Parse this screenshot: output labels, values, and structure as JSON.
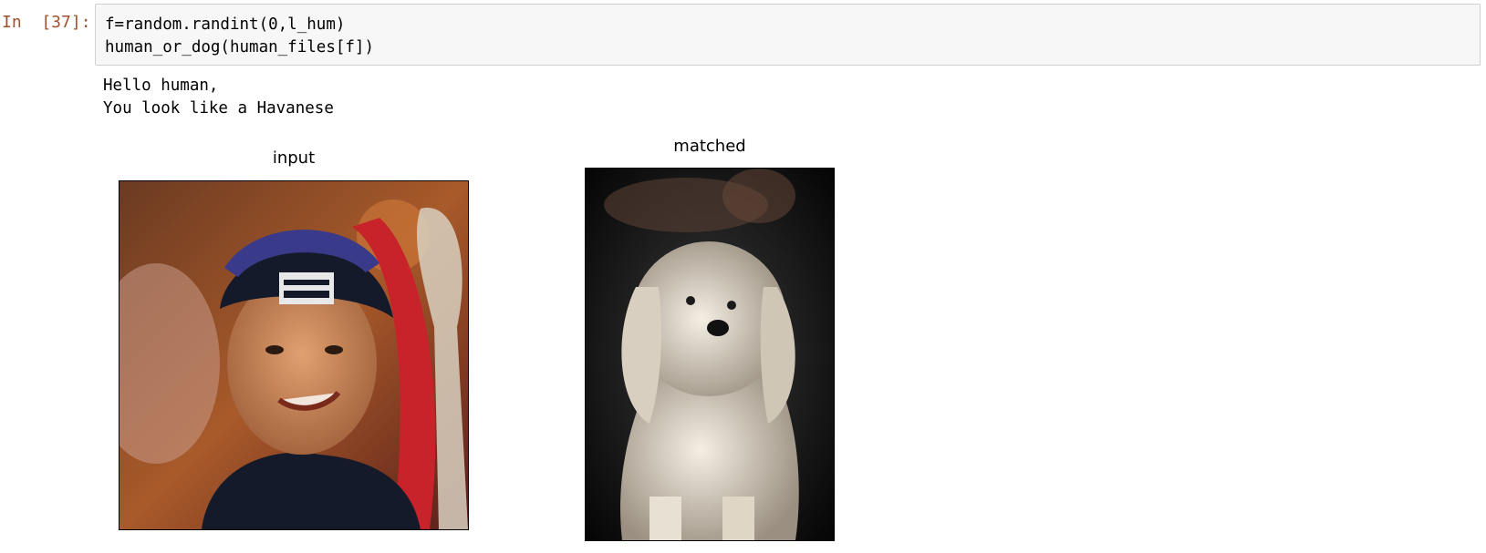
{
  "cell": {
    "prompt": "In  [37]:",
    "code_lines": [
      "f=random.randint(0,l_hum)",
      "human_or_dog(human_files[f])"
    ],
    "output_lines": [
      "Hello human,",
      "You look like a Havanese"
    ]
  },
  "figure": {
    "left_title": "input",
    "right_title": "matched"
  }
}
